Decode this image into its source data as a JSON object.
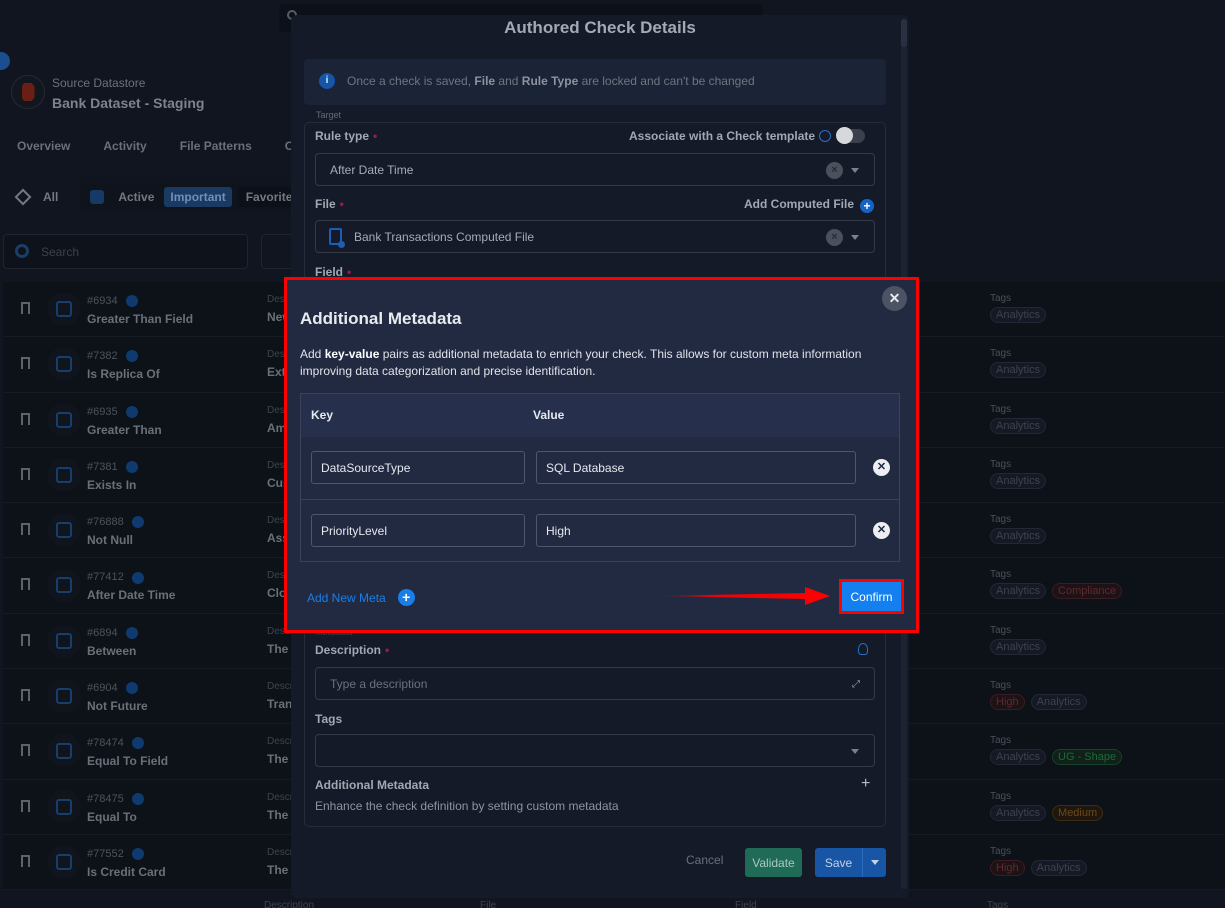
{
  "background": {
    "datastore": {
      "subtitle": "Source Datastore",
      "title": "Bank Dataset - Staging"
    },
    "nav_tabs": [
      "Overview",
      "Activity",
      "File Patterns",
      "Ol"
    ],
    "filters": {
      "all": "All",
      "active": "Active",
      "important": "Important",
      "favorite": "Favorite"
    },
    "search_placeholder": "Search",
    "description_label": "Description",
    "tags_label": "Tags",
    "rows": [
      {
        "id": "#6934",
        "name": "Greater Than Field",
        "desc": "New",
        "tags": [
          {
            "label": "Analytics",
            "tone": "gray"
          }
        ]
      },
      {
        "id": "#7382",
        "name": "Is Replica Of",
        "desc": "Exte",
        "tags": [
          {
            "label": "Analytics",
            "tone": "gray"
          }
        ]
      },
      {
        "id": "#6935",
        "name": "Greater Than",
        "desc": "Am",
        "tags": [
          {
            "label": "Analytics",
            "tone": "gray"
          }
        ]
      },
      {
        "id": "#7381",
        "name": "Exists In",
        "desc": "Cus",
        "tags": [
          {
            "label": "Analytics",
            "tone": "gray"
          }
        ]
      },
      {
        "id": "#76888",
        "name": "Not Null",
        "desc": "Ass",
        "tags": [
          {
            "label": "Analytics",
            "tone": "gray"
          }
        ]
      },
      {
        "id": "#77412",
        "name": "After Date Time",
        "desc": "Clo",
        "tags": [
          {
            "label": "Analytics",
            "tone": "gray"
          },
          {
            "label": "Compliance",
            "tone": "red"
          }
        ]
      },
      {
        "id": "#6894",
        "name": "Between",
        "desc": "The",
        "tags": [
          {
            "label": "Analytics",
            "tone": "gray"
          }
        ]
      },
      {
        "id": "#6904",
        "name": "Not Future",
        "desc": "Tran",
        "tags": [
          {
            "label": "High",
            "tone": "red"
          },
          {
            "label": "Analytics",
            "tone": "gray"
          }
        ]
      },
      {
        "id": "#78474",
        "name": "Equal To Field",
        "desc": "The",
        "tags": [
          {
            "label": "Analytics",
            "tone": "gray"
          },
          {
            "label": "UG - Shape",
            "tone": "green"
          }
        ]
      },
      {
        "id": "#78475",
        "name": "Equal To",
        "desc": "The",
        "tags": [
          {
            "label": "Analytics",
            "tone": "gray"
          },
          {
            "label": "Medium",
            "tone": "orange"
          }
        ]
      },
      {
        "id": "#77552",
        "name": "Is Credit Card",
        "desc": "The",
        "tags": [
          {
            "label": "High",
            "tone": "red"
          },
          {
            "label": "Analytics",
            "tone": "gray"
          }
        ]
      }
    ],
    "last_row_labels": [
      "Description",
      "File",
      "Field",
      "Tags"
    ]
  },
  "check_modal": {
    "title": "Authored Check Details",
    "info_banner": {
      "prefix": "Once a check is saved, ",
      "file": "File",
      "and": " and ",
      "rule_type": "Rule Type",
      "suffix": " are locked and can't be changed"
    },
    "target_legend": "Target",
    "rule_type": {
      "label": "Rule type",
      "value": "After Date Time"
    },
    "associate_template": {
      "label": "Associate with a Check template",
      "enabled": false
    },
    "file": {
      "label": "File",
      "value": "Bank Transactions Computed File",
      "add_computed_label": "Add Computed File"
    },
    "field_label": "Field",
    "metadata_legend": "Metadata",
    "description": {
      "label": "Description",
      "placeholder": "Type a description"
    },
    "tags": {
      "label": "Tags",
      "value": ""
    },
    "additional_metadata": {
      "label": "Additional Metadata",
      "description": "Enhance the check definition by setting custom metadata"
    },
    "buttons": {
      "cancel": "Cancel",
      "validate": "Validate",
      "save": "Save"
    }
  },
  "metadata_dialog": {
    "title": "Additional Metadata",
    "text_prefix": "Add ",
    "text_bold": "key-value",
    "text_suffix": " pairs as additional metadata to enrich your check. This allows for custom meta information improving data categorization and precise identification.",
    "columns": {
      "key": "Key",
      "value": "Value"
    },
    "entries": [
      {
        "key": "DataSourceType",
        "value": "SQL Database"
      },
      {
        "key": "PriorityLevel",
        "value": "High"
      }
    ],
    "add_new_label": "Add New Meta",
    "confirm_label": "Confirm"
  },
  "colors": {
    "annotation_red": "#ff0000",
    "confirm_blue": "#1480f0",
    "dialog_bg": "#222a42",
    "validate_green": "#1f6b57",
    "save_blue": "#1855a4"
  }
}
